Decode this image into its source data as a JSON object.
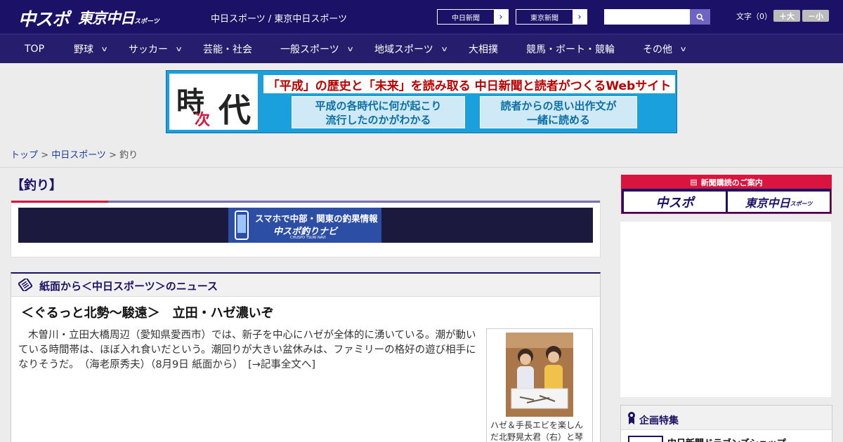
{
  "header": {
    "logo_main": "中スポ",
    "logo_tokyo": "東京中日",
    "logo_tokyo_sub": "スポーツ",
    "site_links": "中日スポーツ / 東京中日スポーツ",
    "chunichi_button": "中日新聞",
    "tokyo_button": "東京新聞",
    "search_placeholder": "",
    "font_size_label": "文字（0）",
    "font_up": "＋大",
    "font_down": "－小"
  },
  "nav": [
    {
      "label": "TOP",
      "dropdown": false
    },
    {
      "label": "野球",
      "dropdown": true
    },
    {
      "label": "サッカー",
      "dropdown": true
    },
    {
      "label": "芸能・社会",
      "dropdown": false
    },
    {
      "label": "一般スポーツ",
      "dropdown": true
    },
    {
      "label": "地域スポーツ",
      "dropdown": true
    },
    {
      "label": "大相撲",
      "dropdown": false
    },
    {
      "label": "競馬・ボート・競輪",
      "dropdown": false
    },
    {
      "label": "その他",
      "dropdown": true
    }
  ],
  "banner": {
    "kanji_1": "時",
    "kanji_2": "次",
    "kanji_3": "代",
    "headline": "「平成」の歴史と「未来」を読み取る 中日新聞と読者がつくるWebサイト",
    "box1_line1": "平成の各時代に何が起こり",
    "box1_line2": "流行したのかがわかる",
    "box2_line1": "読者からの思い出作文が",
    "box2_line2": "一緒に読める"
  },
  "breadcrumb": {
    "home": "トップ",
    "sep": " > ",
    "section": "中日スポーツ",
    "current": "釣り"
  },
  "category": {
    "title": "【釣り】",
    "promo_line1": "スマホで中部・関東の釣果情報",
    "promo_line2": "中スポ釣りナビ",
    "promo_line3": "CHUSPO TSURI NAVI"
  },
  "news": {
    "section_title": "紙面から＜中日スポーツ＞のニュース",
    "headline": "＜ぐるっと北勢～駿遠＞　立田・ハゼ濃いぞ",
    "body": "木曽川・立田大橋周辺（愛知県愛西市）では、新子を中心にハゼが全体的に湧いている。潮が動いている時間帯は、ほぼ入れ食いだという。潮回りが大きい盆休みは、ファミリーの格好の遊び相手になりそうだ。　（海老原秀夫）（8月9日 紙面から）　[→記事全文へ]",
    "photo_caption": "ハゼ＆手長エビを楽しんだ北野晃太君（右）と琴"
  },
  "sidebar": {
    "subscribe_header": "新聞購読のご案内",
    "subscribe_chuspo": "中スポ",
    "subscribe_tokyo": "東京中日",
    "subscribe_tokyo_sub": "スポーツ",
    "feature_title": "企画特集",
    "feature_item": "中日新聞ドラゴンズショップ"
  },
  "colors": {
    "header_bg": "#1b1167",
    "accent_red": "#d9143e",
    "link": "#1b3ca0"
  }
}
